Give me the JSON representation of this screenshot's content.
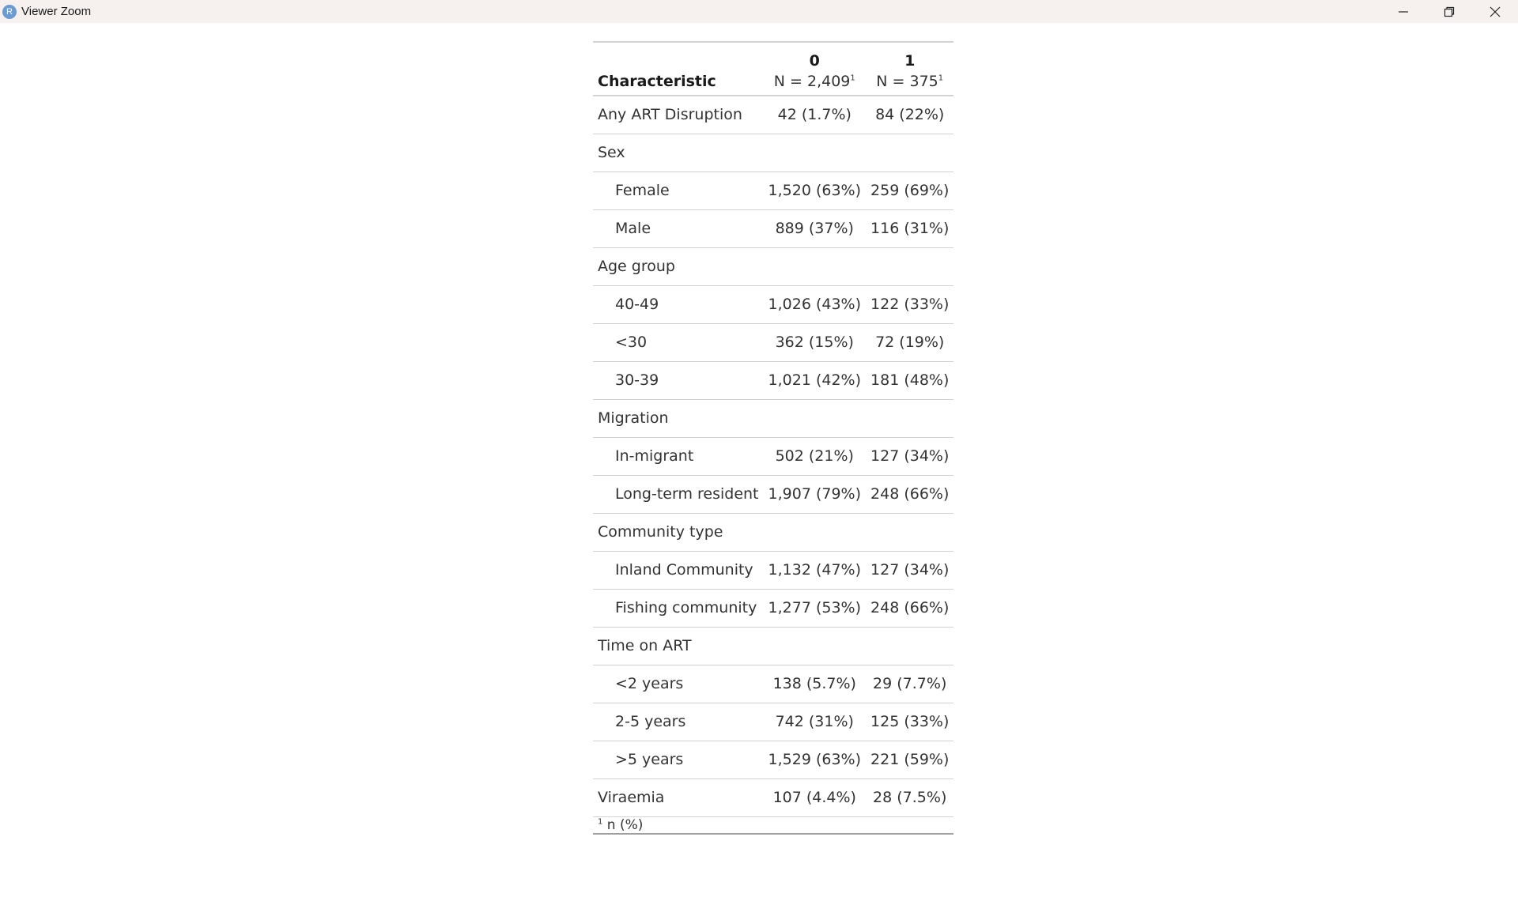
{
  "window": {
    "title": "Viewer Zoom",
    "app_icon_letter": "R"
  },
  "table": {
    "header": {
      "characteristic": "Characteristic",
      "col0_label": "0",
      "col0_n": "N = 2,409",
      "col1_label": "1",
      "col1_n": "N = 375",
      "footnote_mark": "1"
    },
    "rows": [
      {
        "label": "Any ART Disruption",
        "indent": false,
        "col0": "42 (1.7%)",
        "col1": "84 (22%)"
      },
      {
        "label": "Sex",
        "indent": false,
        "col0": "",
        "col1": ""
      },
      {
        "label": "Female",
        "indent": true,
        "col0": "1,520 (63%)",
        "col1": "259 (69%)"
      },
      {
        "label": "Male",
        "indent": true,
        "col0": "889 (37%)",
        "col1": "116 (31%)"
      },
      {
        "label": "Age group",
        "indent": false,
        "col0": "",
        "col1": ""
      },
      {
        "label": "40-49",
        "indent": true,
        "col0": "1,026 (43%)",
        "col1": "122 (33%)"
      },
      {
        "label": "<30",
        "indent": true,
        "col0": "362 (15%)",
        "col1": "72 (19%)"
      },
      {
        "label": "30-39",
        "indent": true,
        "col0": "1,021 (42%)",
        "col1": "181 (48%)"
      },
      {
        "label": "Migration",
        "indent": false,
        "col0": "",
        "col1": ""
      },
      {
        "label": "In-migrant",
        "indent": true,
        "col0": "502 (21%)",
        "col1": "127 (34%)"
      },
      {
        "label": "Long-term resident",
        "indent": true,
        "col0": "1,907 (79%)",
        "col1": "248 (66%)"
      },
      {
        "label": "Community type",
        "indent": false,
        "col0": "",
        "col1": ""
      },
      {
        "label": "Inland Community",
        "indent": true,
        "col0": "1,132 (47%)",
        "col1": "127 (34%)"
      },
      {
        "label": "Fishing community",
        "indent": true,
        "col0": "1,277 (53%)",
        "col1": "248 (66%)"
      },
      {
        "label": "Time on ART",
        "indent": false,
        "col0": "",
        "col1": ""
      },
      {
        "label": "<2 years",
        "indent": true,
        "col0": "138 (5.7%)",
        "col1": "29 (7.7%)"
      },
      {
        "label": "2-5 years",
        "indent": true,
        "col0": "742 (31%)",
        "col1": "125 (33%)"
      },
      {
        "label": ">5 years",
        "indent": true,
        "col0": "1,529 (63%)",
        "col1": "221 (59%)"
      },
      {
        "label": "Viraemia",
        "indent": false,
        "col0": "107 (4.4%)",
        "col1": "28 (7.5%)"
      }
    ],
    "footnote": {
      "mark": "1",
      "text": "n (%)"
    }
  }
}
